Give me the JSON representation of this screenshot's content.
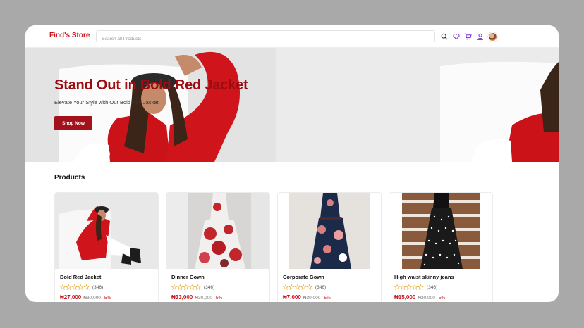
{
  "brand": {
    "name": "Find's Store"
  },
  "search": {
    "placeholder": "Search all Products"
  },
  "nav_icons": [
    "search-icon",
    "heart-icon",
    "cart-icon",
    "user-icon",
    "avatar"
  ],
  "hero": {
    "title": "Stand Out in Bold Red Jacket",
    "subtitle": "Elevate Your Style with Our Bold Red Jacket",
    "cta_label": "Shop Now"
  },
  "products": {
    "title": "Products",
    "items": [
      {
        "name": "Bold Red Jacket",
        "rating_count": "(346)",
        "price": "₦27,000",
        "old_price": "₦30,000",
        "discount": "5%"
      },
      {
        "name": "Dinner Gown",
        "rating_count": "(346)",
        "price": "₦33,000",
        "old_price": "₦30,000",
        "discount": "5%"
      },
      {
        "name": "Corporate Gown",
        "rating_count": "(346)",
        "price": "₦7,000",
        "old_price": "₦30,000",
        "discount": "5%"
      },
      {
        "name": "High waist skinny jeans",
        "rating_count": "(346)",
        "price": "₦15,000",
        "old_price": "₦30,000",
        "discount": "5%"
      }
    ]
  },
  "colors": {
    "brand_red": "#c8161d",
    "hero_red": "#9c0d12",
    "icon_purple": "#7a2bd6"
  }
}
